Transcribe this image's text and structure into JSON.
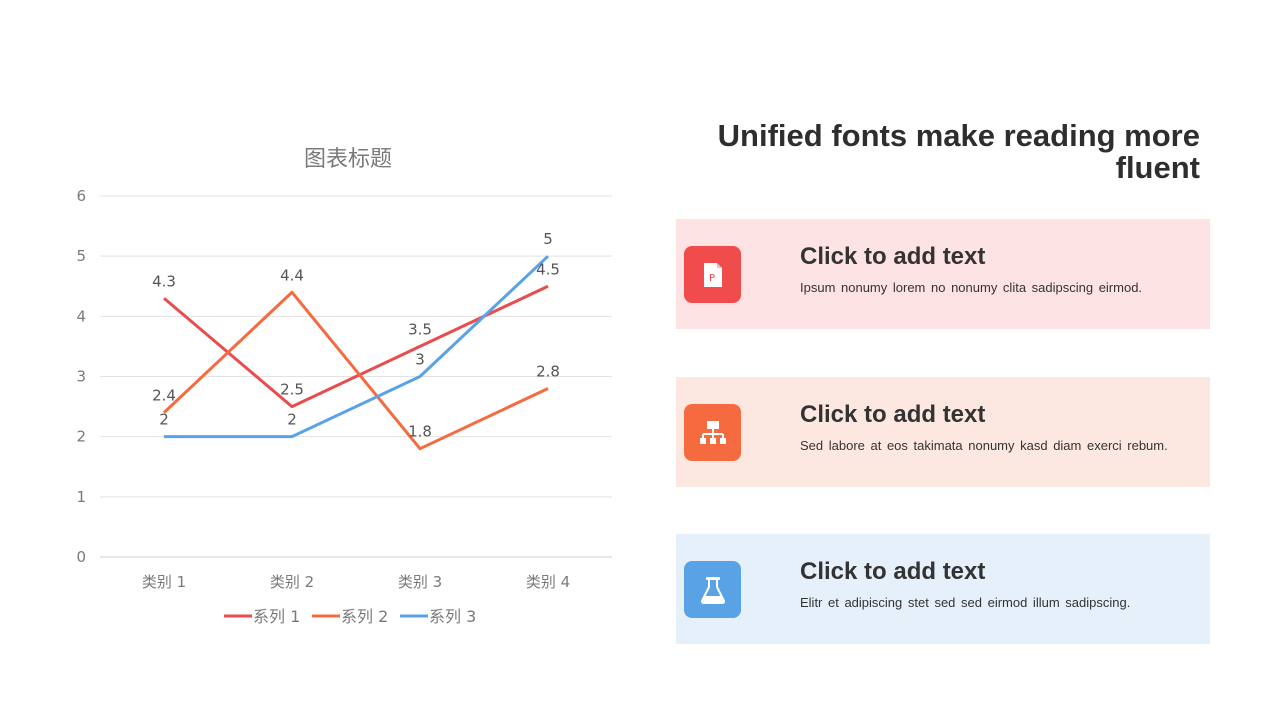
{
  "chart_data": {
    "type": "line",
    "title": "图表标题",
    "categories": [
      "类别 1",
      "类别 2",
      "类别 3",
      "类别 4"
    ],
    "ylim": [
      0,
      6
    ],
    "yticks": [
      0,
      1,
      2,
      3,
      4,
      5,
      6
    ],
    "grid": true,
    "legend_position": "bottom",
    "series": [
      {
        "name": "系列 1",
        "values": [
          4.3,
          2.5,
          3.5,
          4.5
        ],
        "color": "#e94c4c"
      },
      {
        "name": "系列 2",
        "values": [
          2.4,
          4.4,
          1.8,
          2.8
        ],
        "color": "#f56b3f"
      },
      {
        "name": "系列 3",
        "values": [
          2,
          2,
          3,
          5
        ],
        "color": "#5aa2e6"
      }
    ]
  },
  "headline": "Unified fonts make reading more fluent",
  "cards": [
    {
      "title": "Click to add text",
      "text": "Ipsum nonumy lorem no nonumy clita sadipscing eirmod.",
      "bg": "#fde3e3",
      "icon_bg": "#f04c4c",
      "icon": "powerpoint-icon"
    },
    {
      "title": "Click to add text",
      "text": "Sed labore at eos takimata nonumy kasd diam exerci rebum.",
      "bg": "#fde8e1",
      "icon_bg": "#f56b3f",
      "icon": "org-chart-icon"
    },
    {
      "title": "Click to add text",
      "text": "Elitr et adipiscing stet sed sed eirmod illum sadipscing.",
      "bg": "#e5f0fb",
      "icon_bg": "#5aa2e6",
      "icon": "flask-icon"
    }
  ]
}
